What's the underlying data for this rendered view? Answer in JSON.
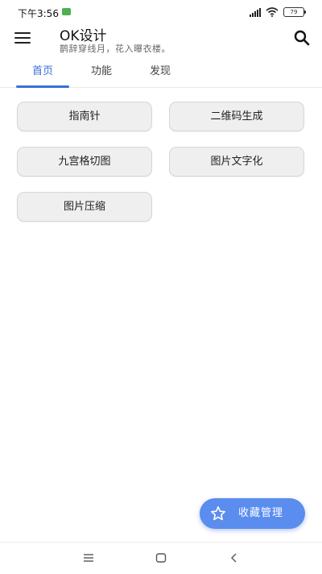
{
  "status_bar": {
    "time": "下午3:56",
    "battery": "79"
  },
  "app_bar": {
    "title": "OK设计",
    "subtitle": "鹊辞穿线月，花入曝衣楼。",
    "menu_icon": "menu-icon",
    "search_icon": "search-icon"
  },
  "tabs": [
    {
      "label": "首页",
      "active": true
    },
    {
      "label": "功能",
      "active": false
    },
    {
      "label": "发现",
      "active": false
    }
  ],
  "tools": [
    {
      "label": "指南针"
    },
    {
      "label": "二维码生成"
    },
    {
      "label": "九宫格切图"
    },
    {
      "label": "图片文字化"
    },
    {
      "label": "图片压缩"
    }
  ],
  "fab": {
    "label": "收藏管理",
    "icon": "star-icon"
  },
  "colors": {
    "accent": "#3a6fd8",
    "fab": "#5b8def",
    "button_bg": "#efefef"
  },
  "nav_bar": {
    "icons": [
      "menu-lines-icon",
      "home-square-icon",
      "back-chevron-icon"
    ]
  }
}
